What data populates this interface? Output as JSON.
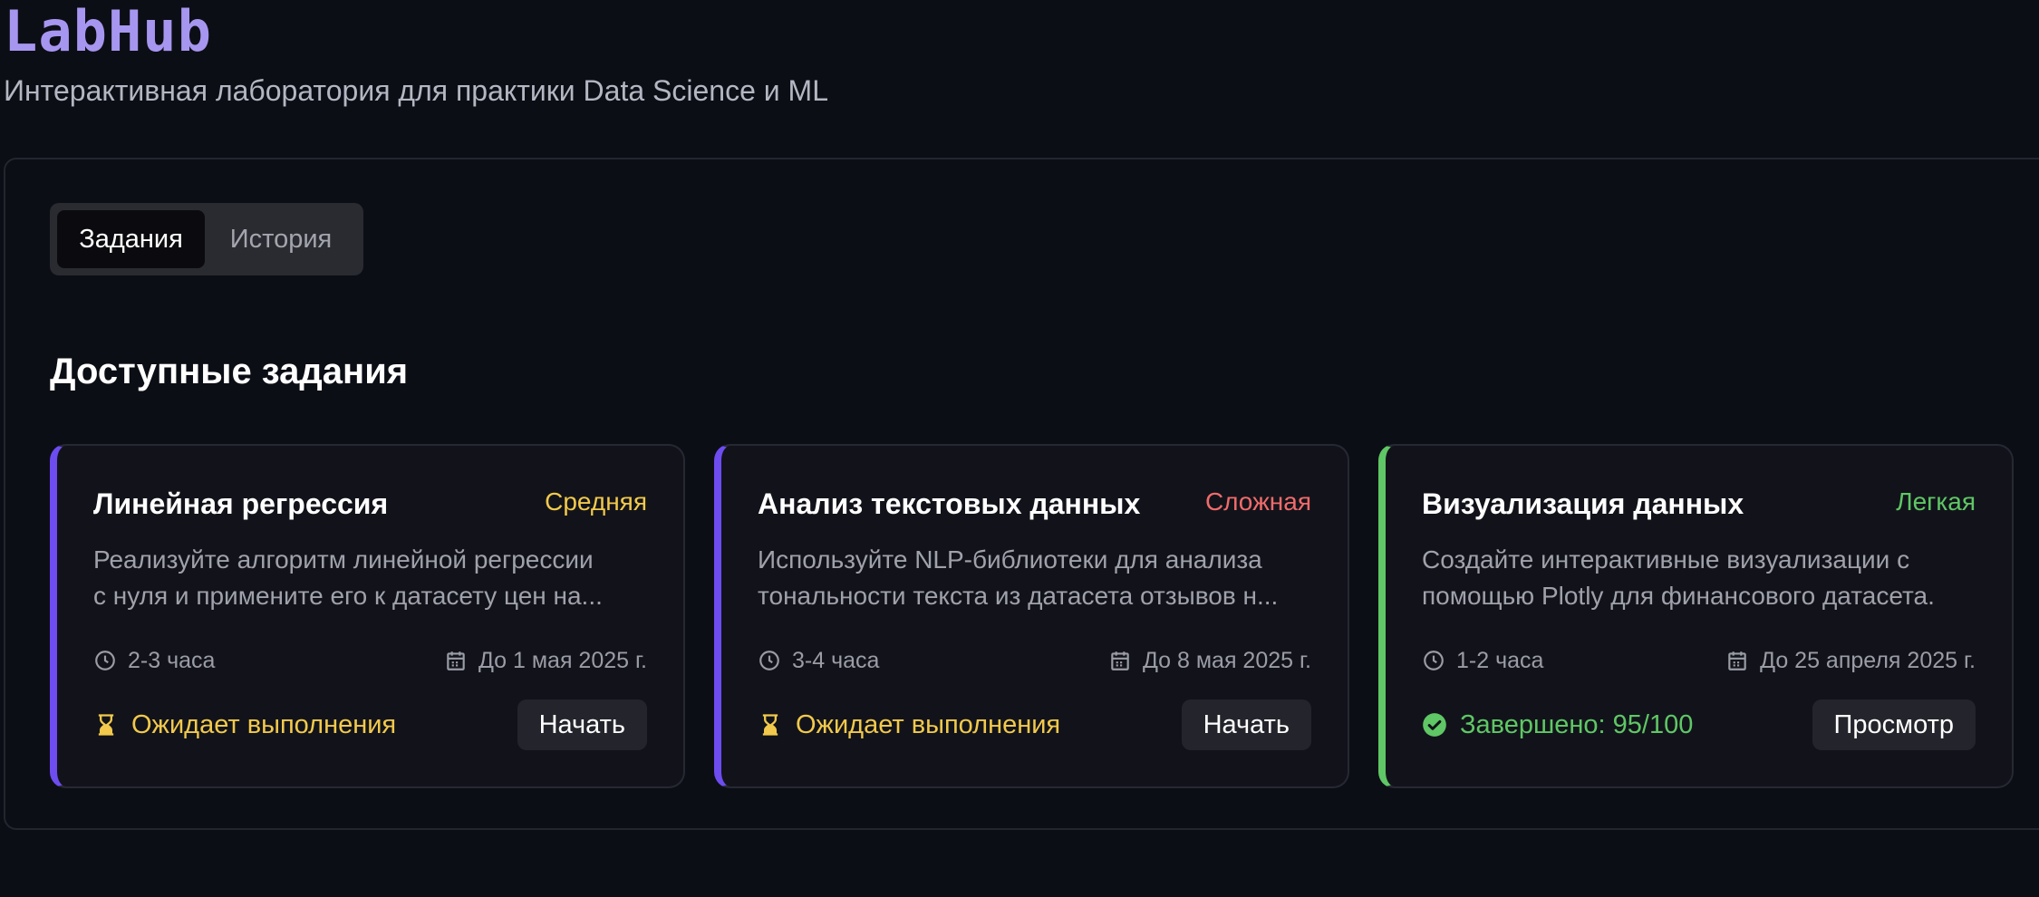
{
  "app": {
    "logo": "LabHub",
    "subtitle": "Интерактивная лаборатория для практики Data Science и ML"
  },
  "tabs": [
    {
      "label": "Задания",
      "active": true
    },
    {
      "label": "История",
      "active": false
    }
  ],
  "section_title": "Доступные задания",
  "colors": {
    "medium": "#f2c94c",
    "hard": "#f06b6b",
    "easy": "#5fc765",
    "pending": "#f2c94c",
    "done": "#5fc765"
  },
  "cards": [
    {
      "title": "Линейная регрессия",
      "difficulty": "Средняя",
      "desc_line1": "Реализуйте алгоритм линейной регрессии",
      "desc_line2": "с нуля и примените его к датасету цен на...",
      "duration": "2-3 часа",
      "deadline": "До 1 мая 2025 г.",
      "status": "Ожидает выполнения",
      "status_icon": "hourglass-icon",
      "button": "Начать"
    },
    {
      "title": "Анализ текстовых данных",
      "difficulty": "Сложная",
      "desc_line1": "Используйте NLP-библиотеки для анализа",
      "desc_line2": "тональности текста из датасета отзывов н...",
      "duration": "3-4 часа",
      "deadline": "До 8 мая 2025 г.",
      "status": "Ожидает выполнения",
      "status_icon": "hourglass-icon",
      "button": "Начать"
    },
    {
      "title": "Визуализация данных",
      "difficulty": "Легкая",
      "desc_line1": "Создайте интерактивные визуализации с",
      "desc_line2": "помощью Plotly для финансового датасета.",
      "duration": "1-2 часа",
      "deadline": "До 25 апреля 2025 г.",
      "status": "Завершено: 95/100",
      "status_icon": "check-circle-icon",
      "button": "Просмотр"
    }
  ]
}
